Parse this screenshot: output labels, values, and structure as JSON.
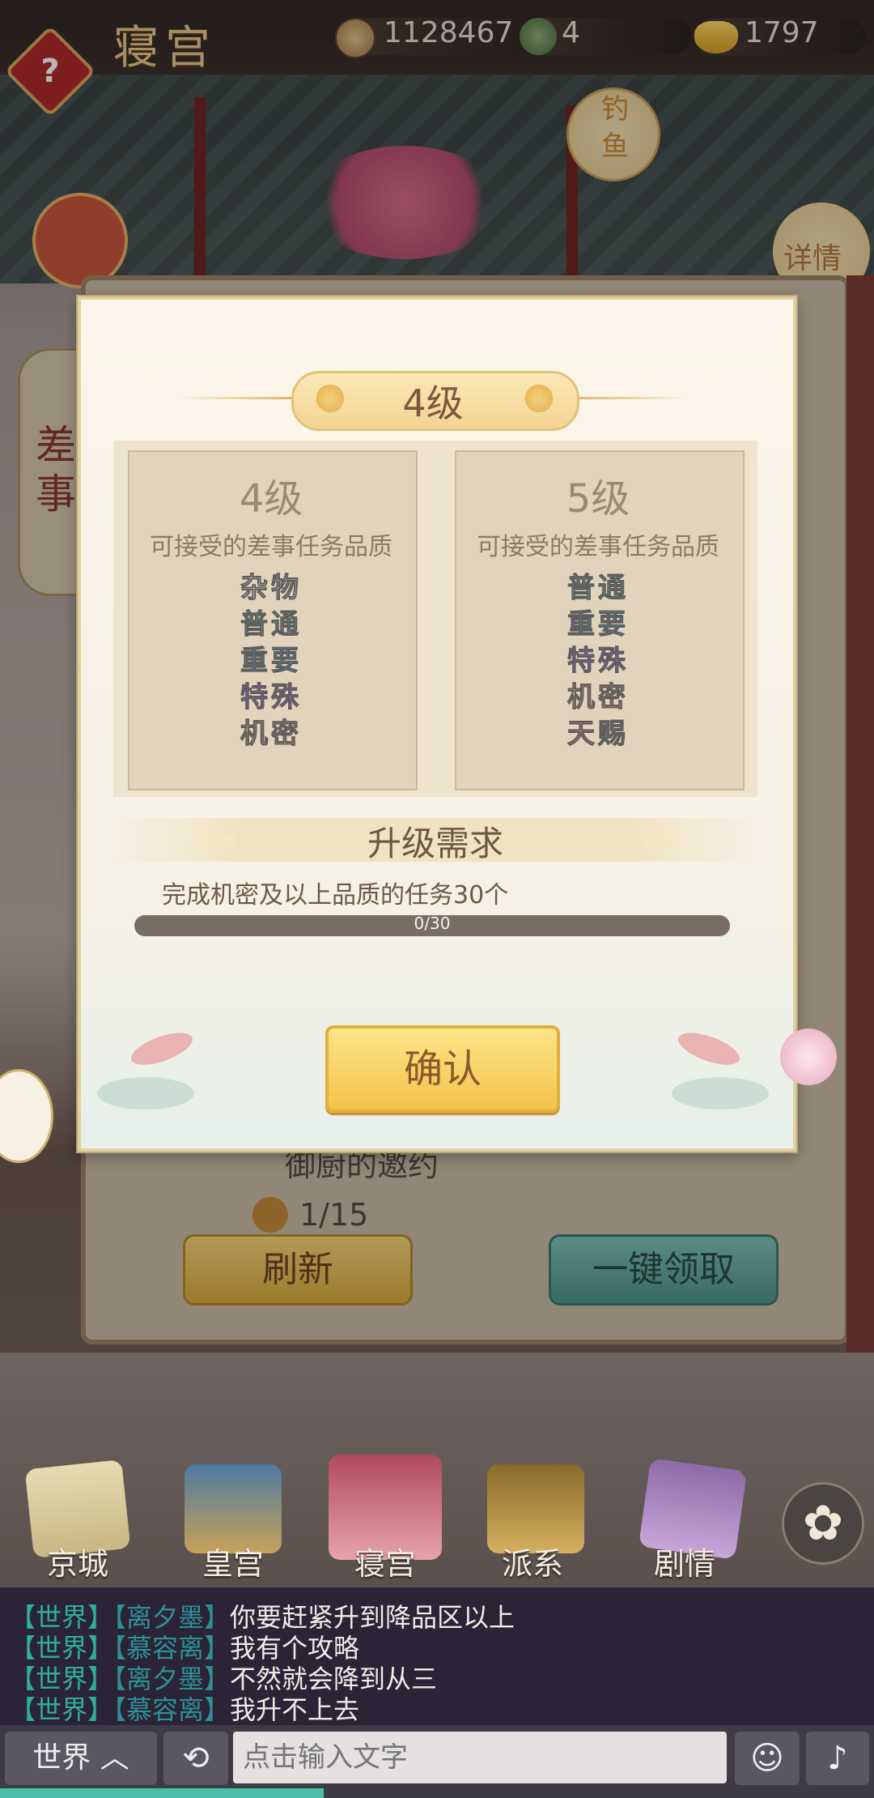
{
  "topbar": {
    "title": "寝宫",
    "help_label": "?",
    "coins": "1128467",
    "gourds": "4",
    "gold": "1797"
  },
  "side_buttons": {
    "fish": "钓鱼",
    "detail": "详情"
  },
  "background_panel": {
    "tab_label": "差事",
    "task_title": "御厨的邀约",
    "task_progress": "1/15",
    "refresh_label": "刷新",
    "claim_all_label": "一键领取"
  },
  "modal": {
    "level_banner": "4级",
    "current": {
      "level": "4级",
      "subtitle": "可接受的差事任务品质",
      "qualities": [
        {
          "label": "杂物",
          "color": "#f4f1ea"
        },
        {
          "label": "普通",
          "color": "#5fc77a"
        },
        {
          "label": "重要",
          "color": "#4aa3f2"
        },
        {
          "label": "特殊",
          "color": "#b84de0"
        },
        {
          "label": "机密",
          "color": "#f2a14a"
        }
      ]
    },
    "next": {
      "level": "5级",
      "subtitle": "可接受的差事任务品质",
      "qualities": [
        {
          "label": "普通",
          "color": "#5fc77a"
        },
        {
          "label": "重要",
          "color": "#4aa3f2"
        },
        {
          "label": "特殊",
          "color": "#b84de0"
        },
        {
          "label": "机密",
          "color": "#f2a14a"
        },
        {
          "label": "天赐",
          "color": "#ee6a7a"
        }
      ]
    },
    "requirement_title": "升级需求",
    "requirement_text": "完成机密及以上品质的任务30个",
    "progress_label": "0/30",
    "progress_value": 0,
    "confirm_label": "确认"
  },
  "bottom_nav": {
    "items": [
      "京城",
      "皇宫",
      "寝宫",
      "派系",
      "剧情"
    ]
  },
  "chat": {
    "lines": [
      {
        "channel": "【世界】",
        "user": "【离夕墨】",
        "msg": "你要赶紧升到降品区以上"
      },
      {
        "channel": "【世界】",
        "user": "【慕容离】",
        "msg": "我有个攻略"
      },
      {
        "channel": "【世界】",
        "user": "【离夕墨】",
        "msg": "不然就会降到从三"
      },
      {
        "channel": "【世界】",
        "user": "【慕容离】",
        "msg": "我升不上去"
      }
    ],
    "channel_button": "世界 ︿",
    "input_placeholder": "点击输入文字"
  }
}
